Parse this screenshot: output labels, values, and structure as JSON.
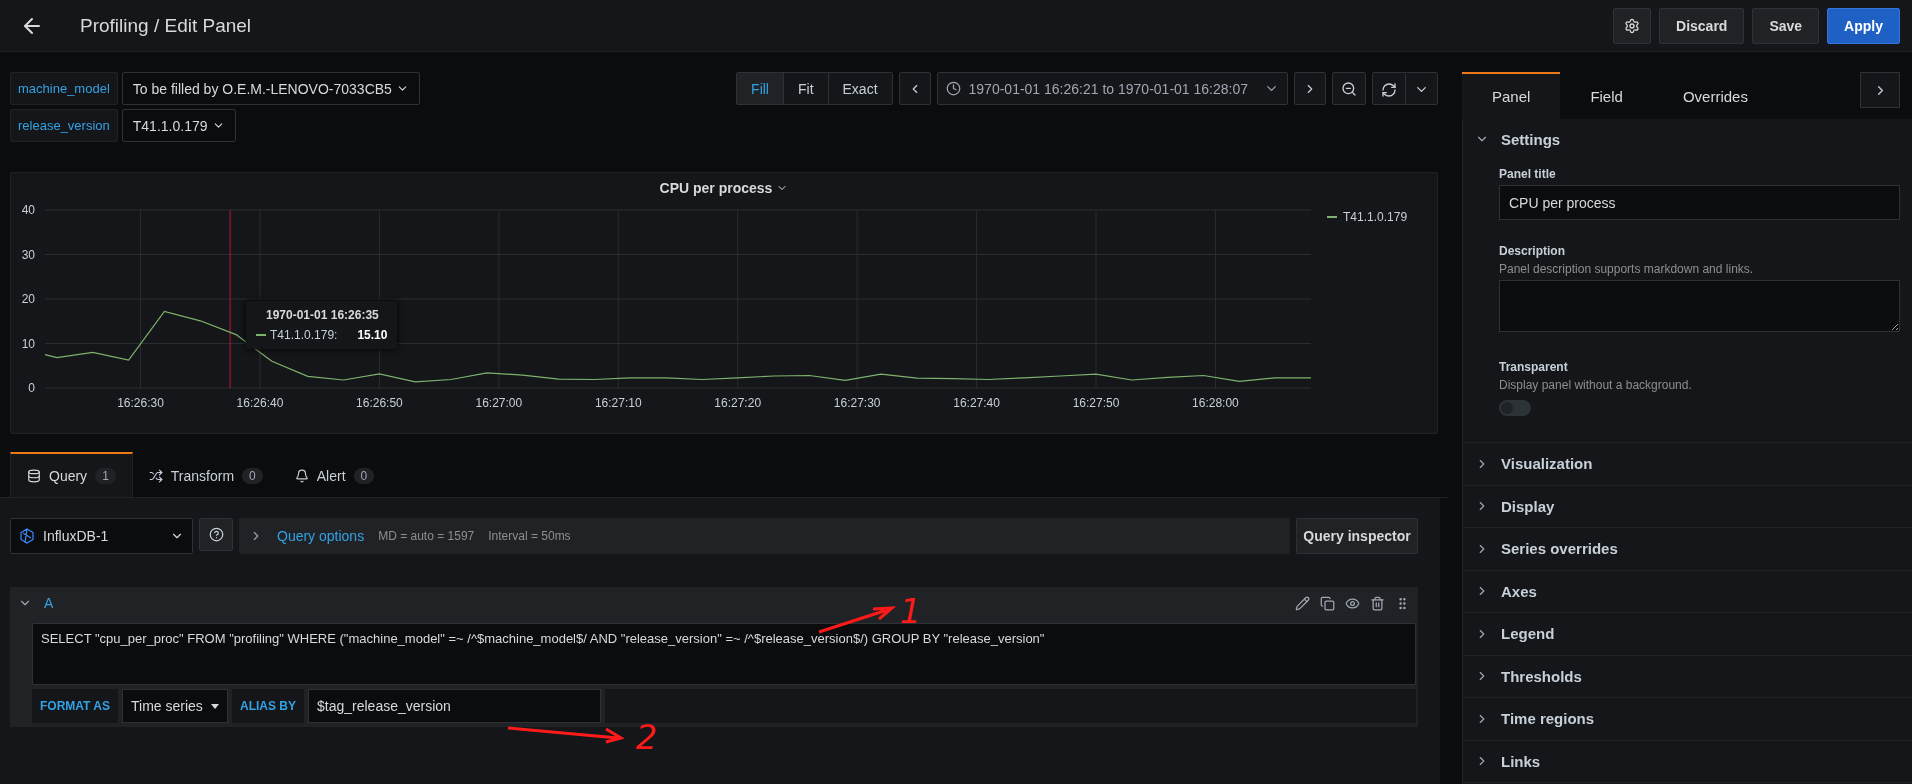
{
  "header": {
    "title": "Profiling / Edit Panel",
    "buttons": [
      {
        "label": "Discard",
        "kind": "secondary"
      },
      {
        "label": "Save",
        "kind": "secondary"
      },
      {
        "label": "Apply",
        "kind": "primary"
      }
    ]
  },
  "variables": [
    {
      "name": "machine_model",
      "value": "To be filled by O.E.M.-LENOVO-7033CB5"
    },
    {
      "name": "release_version",
      "value": "T41.1.0.179"
    }
  ],
  "zoom_modes": [
    {
      "label": "Fill",
      "selected": true
    },
    {
      "label": "Fit",
      "selected": false
    },
    {
      "label": "Exact",
      "selected": false
    }
  ],
  "time_range": "1970-01-01 16:26:21 to 1970-01-01 16:28:07",
  "panel": {
    "title": "CPU per process",
    "tooltip": {
      "time": "1970-01-01 16:26:35",
      "series": "T41.1.0.179:",
      "value": "15.10",
      "color": "#7eb26d"
    },
    "chart_data": {
      "type": "line",
      "x": [
        59182,
        59183,
        59186,
        59189,
        59192,
        59195,
        59198,
        59201,
        59204,
        59207,
        59210,
        59213,
        59216,
        59219,
        59222,
        59225,
        59228,
        59231,
        59234,
        59237,
        59240,
        59243,
        59246,
        59249,
        59252,
        59255,
        59258,
        59261,
        59264,
        59267,
        59270,
        59273,
        59276,
        59279,
        59282,
        59285,
        59288
      ],
      "series": [
        {
          "name": "T41.1.0.179",
          "color": "#7eb26d",
          "values": [
            7.5,
            6.8,
            8,
            6.3,
            17.2,
            15.1,
            12,
            6,
            2.6,
            1.8,
            3.2,
            1.4,
            1.9,
            3.4,
            2.9,
            2,
            1.9,
            2.3,
            2.3,
            1.9,
            2.3,
            2.7,
            2.8,
            1.7,
            3.1,
            2.2,
            2.1,
            1.9,
            2.3,
            2.7,
            3.1,
            1.8,
            2.4,
            2.8,
            1.5,
            2.3,
            2.3
          ]
        }
      ],
      "xlim": [
        59182,
        59288
      ],
      "ylim": [
        0,
        40
      ],
      "yticks": [
        0,
        10,
        20,
        30,
        40
      ],
      "xticks": [
        {
          "value": 59190,
          "label": "16:26:30"
        },
        {
          "value": 59200,
          "label": "16:26:40"
        },
        {
          "value": 59210,
          "label": "16:26:50"
        },
        {
          "value": 59220,
          "label": "16:27:00"
        },
        {
          "value": 59230,
          "label": "16:27:10"
        },
        {
          "value": 59240,
          "label": "16:27:20"
        },
        {
          "value": 59250,
          "label": "16:27:30"
        },
        {
          "value": 59260,
          "label": "16:27:40"
        },
        {
          "value": 59270,
          "label": "16:27:50"
        },
        {
          "value": 59280,
          "label": "16:28:00"
        }
      ],
      "grid": true,
      "ref_lines": [
        {
          "axis": "x",
          "value": 59197.5,
          "color": "#c4162a"
        }
      ]
    }
  },
  "query_tabs": [
    {
      "label": "Query",
      "count": "1",
      "selected": true
    },
    {
      "label": "Transform",
      "count": "0",
      "selected": false
    },
    {
      "label": "Alert",
      "count": "0",
      "selected": false
    }
  ],
  "datasource": "InfluxDB-1",
  "query_options": {
    "label": "Query options",
    "info": [
      "MD = auto = 1597",
      "Interval = 50ms"
    ]
  },
  "query_inspector": "Query inspector",
  "queries": [
    {
      "ref": "A",
      "expanded": true,
      "text": "SELECT \"cpu_per_proc\" FROM \"profiling\" WHERE (\"machine_model\" =~ /^$machine_model$/ AND \"release_version\" =~ /^$release_version$/) GROUP BY \"release_version\"",
      "format_label": "FORMAT AS",
      "format": "Time series",
      "alias_label": "ALIAS BY",
      "alias": "$tag_release_version"
    }
  ],
  "annotations": [
    {
      "label": "1"
    },
    {
      "label": "2"
    }
  ],
  "options_tabs": [
    {
      "label": "Panel",
      "selected": true
    },
    {
      "label": "Field",
      "selected": false
    },
    {
      "label": "Overrides",
      "selected": false
    }
  ],
  "settings": {
    "title": "Settings",
    "expanded": true,
    "panel_title_label": "Panel title",
    "panel_title": "CPU per process",
    "description_label": "Description",
    "description_help": "Panel description supports markdown and links.",
    "transparent_label": "Transparent",
    "transparent_help": "Display panel without a background.",
    "transparent_on": false
  },
  "sections": [
    {
      "title": "Visualization",
      "expanded": false
    },
    {
      "title": "Display",
      "expanded": false
    },
    {
      "title": "Series overrides",
      "expanded": false
    },
    {
      "title": "Axes",
      "expanded": false
    },
    {
      "title": "Legend",
      "expanded": false
    },
    {
      "title": "Thresholds",
      "expanded": false
    },
    {
      "title": "Time regions",
      "expanded": false
    },
    {
      "title": "Links",
      "expanded": false
    }
  ]
}
